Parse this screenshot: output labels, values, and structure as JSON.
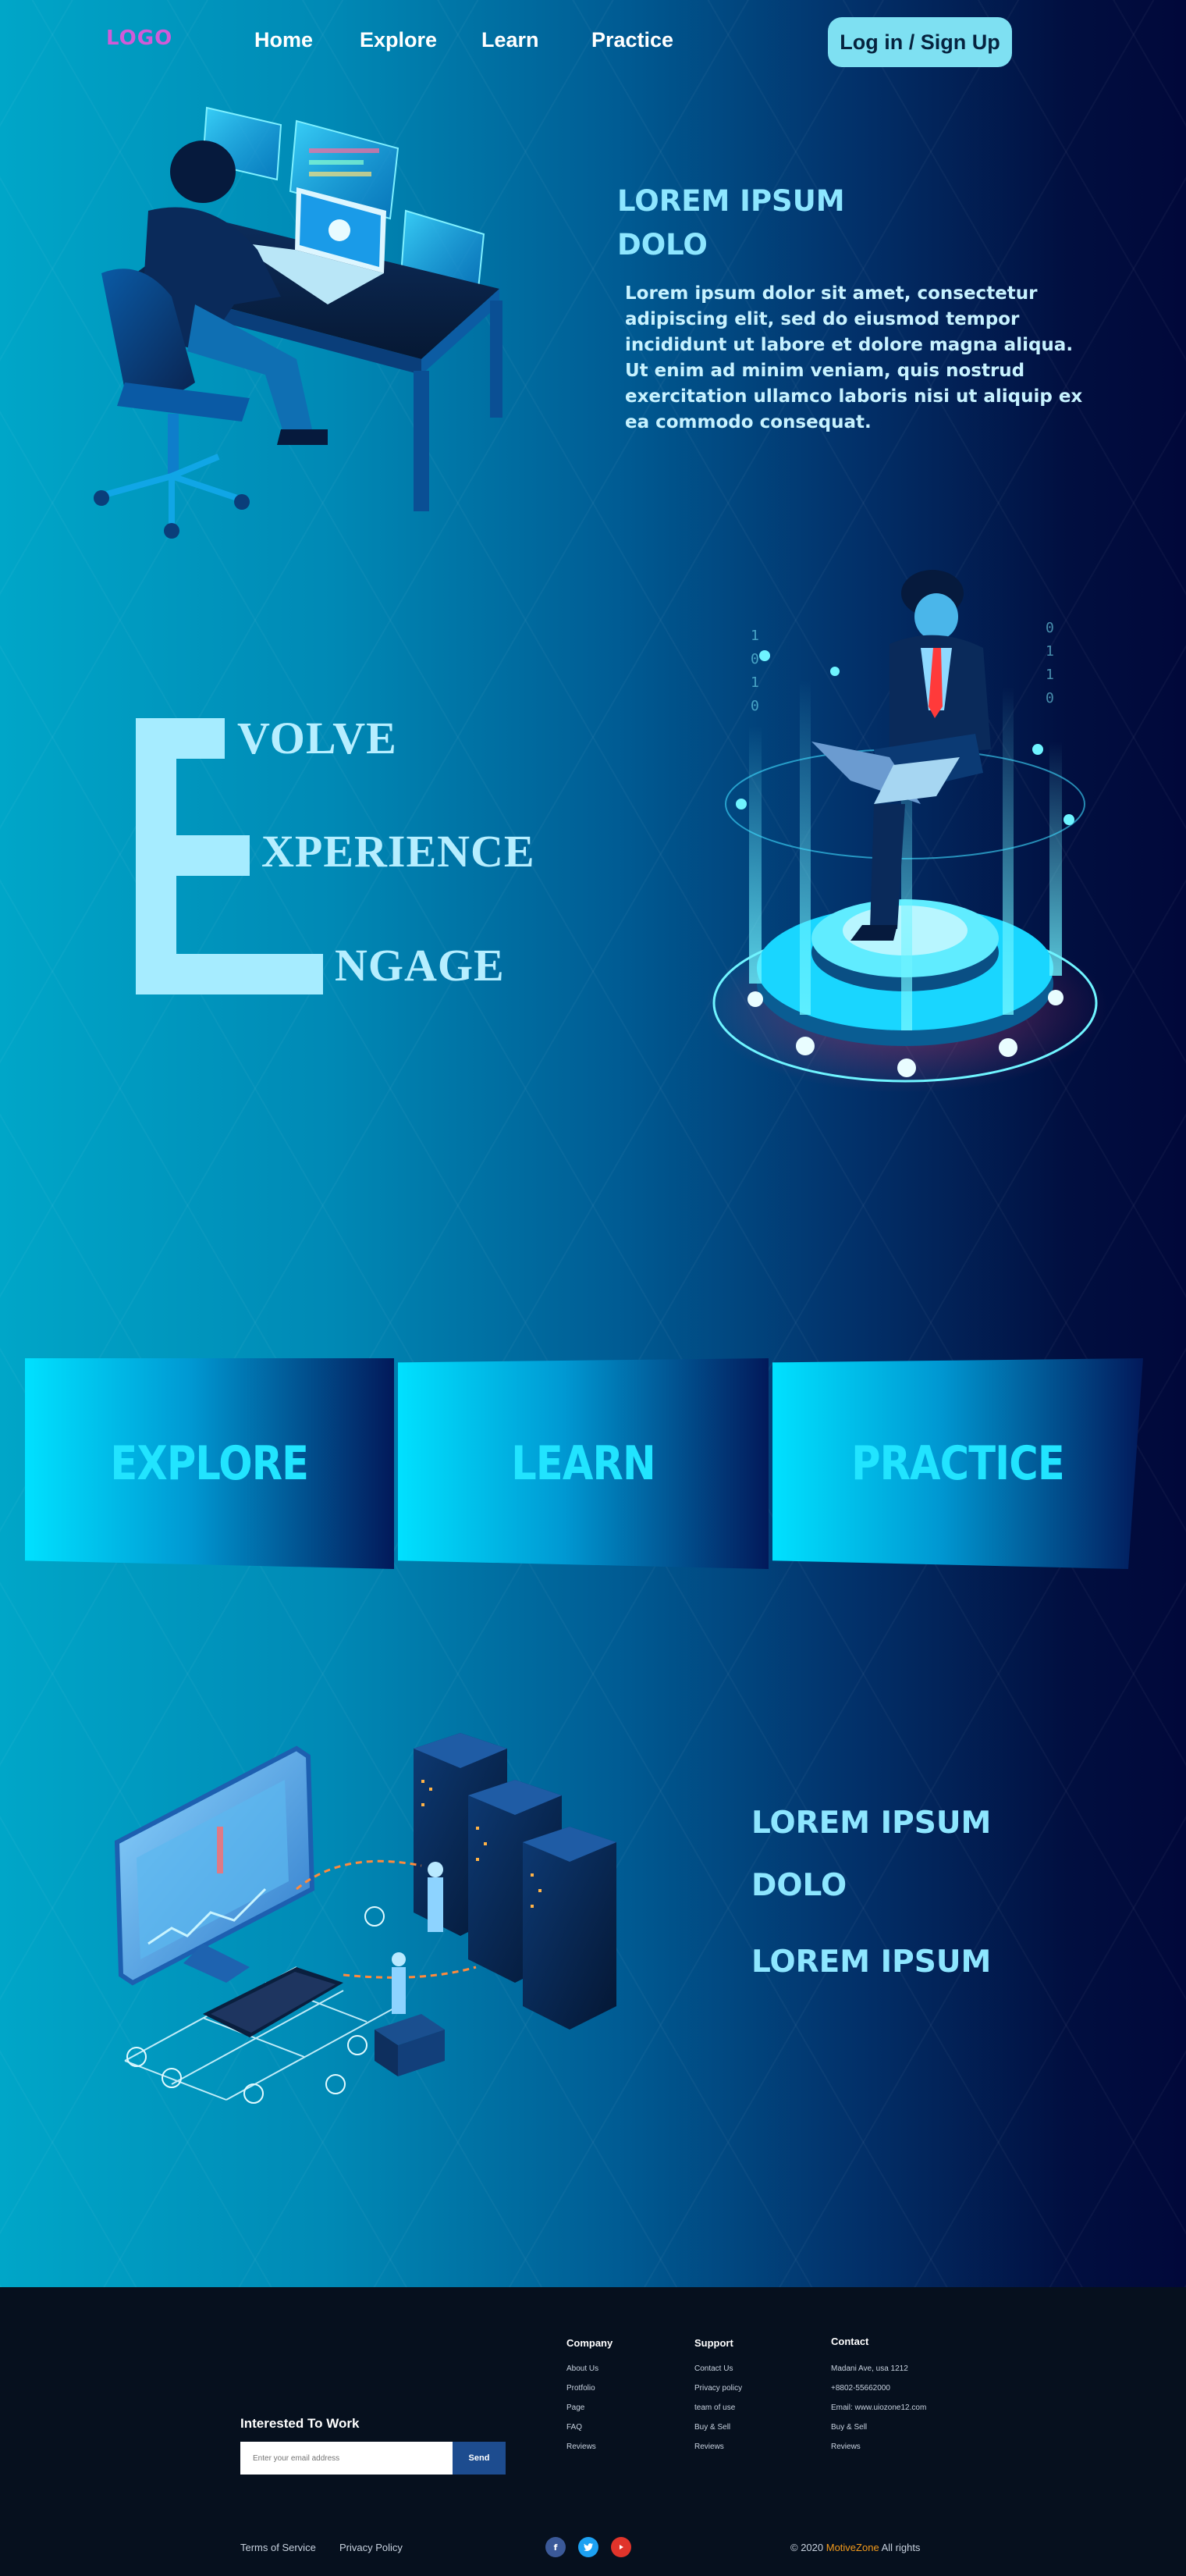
{
  "colors": {
    "accent_cyan": "#8de6ff",
    "logo_magenta": "#d15bd8",
    "button_bg": "#7ee0f2",
    "footer_bg": "#06101e",
    "brand_orange": "#f29a1c",
    "facebook_blue": "#3b5998",
    "twitter_blue": "#1da1f2",
    "youtube_red": "#e0342b"
  },
  "nav": {
    "logo": "LOGO",
    "links": [
      "Home",
      "Explore",
      "Learn",
      "Practice"
    ],
    "login_label": "Log in / Sign Up"
  },
  "section1": {
    "headline_line1": "LOREM IPSUM",
    "headline_line2": "DOLO",
    "paragraph_lines": [
      "Lorem ipsum dolor sit amet, consectetur",
      "adipiscing elit, sed do eiusmod tempor",
      "incididunt ut labore et dolore magna aliqua.",
      "Ut enim ad minim veniam, quis nostrud",
      "exercitation ullamco laboris nisi ut aliquip ex",
      "ea commodo consequat."
    ],
    "illustration_icon": "developer-at-desk-icon"
  },
  "section2": {
    "big_letter": "E",
    "words": [
      "VOLVE",
      "XPERIENCE",
      "NGAGE"
    ],
    "illustration_icon": "man-on-data-platform-icon"
  },
  "cards": [
    "EXPLORE",
    "LEARN",
    "PRACTICE"
  ],
  "section3": {
    "line1": "LOREM IPSUM",
    "line2": "DOLO",
    "line3": "LOREM IPSUM",
    "illustration_icon": "server-network-icon"
  },
  "footer": {
    "interest_title": "Interested To Work",
    "email_placeholder": "Enter your email address",
    "send_label": "Send",
    "columns": [
      {
        "title": "Company",
        "items": [
          "About Us",
          "Protfolio",
          "Page",
          "FAQ",
          "Reviews"
        ]
      },
      {
        "title": "Support",
        "items": [
          "Contact Us",
          "Privacy policy",
          "team of use",
          "Buy & Sell",
          "Reviews"
        ]
      },
      {
        "title": "Contact",
        "items": [
          "Madani Ave, usa 1212",
          "+8802-55662000",
          "Email: www.uiozone12.com",
          "Buy & Sell",
          "Reviews"
        ]
      }
    ],
    "bottom_links": [
      "Terms of Service",
      "Privacy Policy"
    ],
    "social_icons": [
      "facebook-icon",
      "twitter-icon",
      "youtube-icon"
    ],
    "copyright_prefix": "© 2020",
    "brand": "MotiveZone",
    "copyright_suffix": "All rights"
  }
}
